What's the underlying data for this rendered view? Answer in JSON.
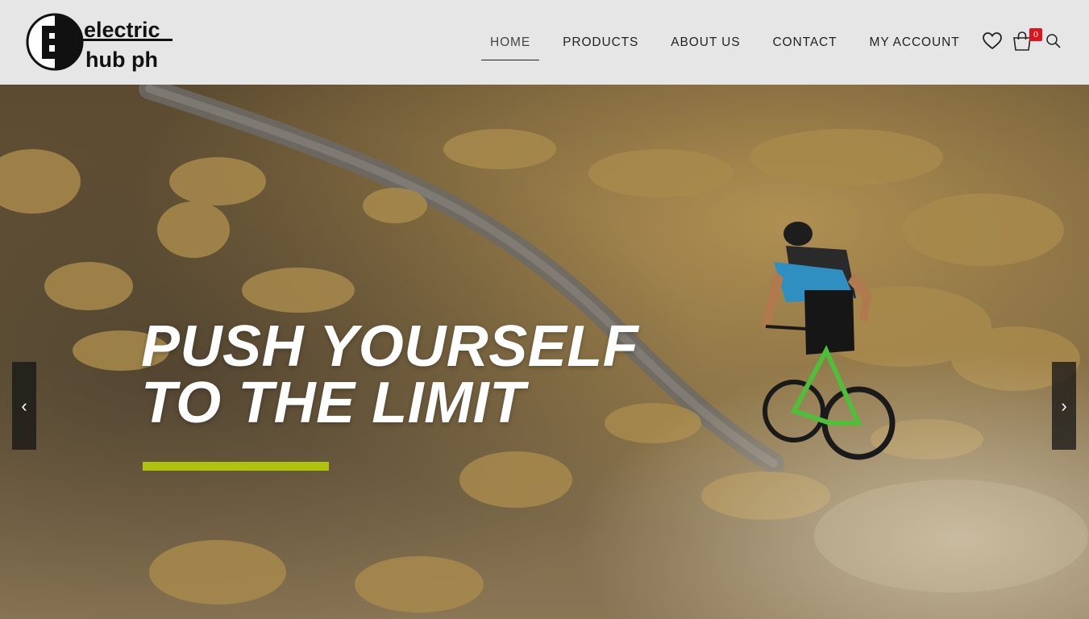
{
  "brand": {
    "logo_word_1": "electric",
    "logo_word_2": "hub ph",
    "logo_letter": "E"
  },
  "nav": {
    "items": [
      {
        "label": "HOME",
        "active": true
      },
      {
        "label": "PRODUCTS",
        "active": false
      },
      {
        "label": "ABOUT US",
        "active": false
      },
      {
        "label": "CONTACT",
        "active": false
      },
      {
        "label": "MY ACCOUNT",
        "active": false
      }
    ]
  },
  "header_icons": {
    "wishlist": "heart-icon",
    "cart": "shopping-bag-icon",
    "cart_count": "0",
    "search": "search-icon"
  },
  "hero": {
    "headline_line_1": "PUSH YOURSELF",
    "headline_line_2": "TO THE LIMIT",
    "accent_color": "#aec20e",
    "prev_arrow": "‹",
    "next_arrow": "›",
    "image": "mountain-biker-on-dusty-trail"
  },
  "colors": {
    "header_bg": "#e6e6e6",
    "badge": "#e0141b",
    "text": "#222222"
  }
}
